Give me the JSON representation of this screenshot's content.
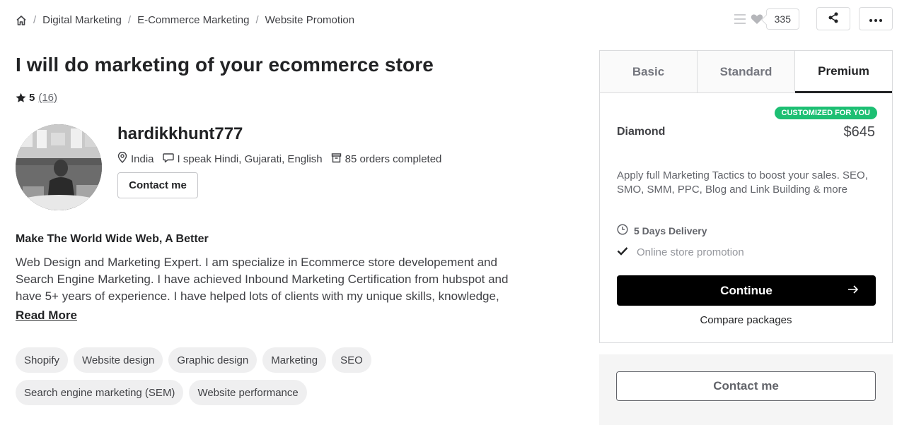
{
  "breadcrumb": {
    "items": [
      "Digital Marketing",
      "E-Commerce Marketing",
      "Website Promotion"
    ]
  },
  "actions": {
    "likes": "335"
  },
  "gig": {
    "title": "I will do marketing of your ecommerce store",
    "rating": "5",
    "review_count": "(16)"
  },
  "seller": {
    "name": "hardikkhunt777",
    "country": "India",
    "languages": "I speak Hindi, Gujarati, English",
    "orders": "85 orders completed",
    "contact_label": "Contact me"
  },
  "about": {
    "heading": "Make The World Wide Web, A Better",
    "text": "Web Design and Marketing Expert. I am specialize in Ecommerce store developement and Search Engine Marketing. I have achieved Inbound Marketing Certification from hubspot and have 5+ years of experience. I have helped lots of clients with my unique skills, knowledge,",
    "read_more": "Read More"
  },
  "tags": [
    "Shopify",
    "Website design",
    "Graphic design",
    "Marketing",
    "SEO",
    "Search engine marketing (SEM)",
    "Website performance"
  ],
  "package": {
    "tabs": [
      "Basic",
      "Standard",
      "Premium"
    ],
    "active_tab": "Premium",
    "badge": "CUSTOMIZED FOR YOU",
    "name": "Diamond",
    "price": "$645",
    "description": "Apply full Marketing Tactics to boost your sales. SEO, SMO, SMM, PPC, Blog and Link Building & more",
    "delivery": "5 Days Delivery",
    "features": [
      "Online store promotion"
    ],
    "continue_label": "Continue",
    "compare_label": "Compare packages"
  },
  "contact_box": {
    "label": "Contact me"
  },
  "colors": {
    "accent_green": "#1dbf73",
    "primary_black": "#000000"
  }
}
